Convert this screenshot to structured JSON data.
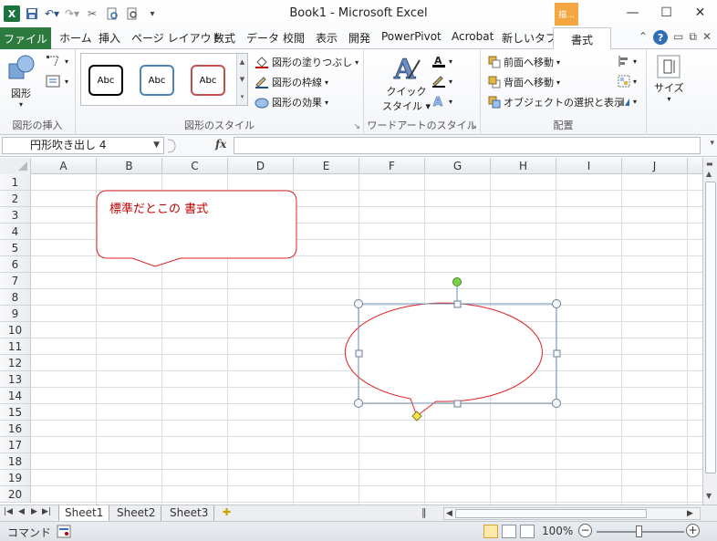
{
  "window": {
    "title": "Book1 - Microsoft Excel",
    "context_tab_header": "描...",
    "minimize_glyph": "—",
    "maximize_glyph": "☐",
    "close_glyph": "✕"
  },
  "qat": {
    "icons": [
      "excel-logo",
      "save-icon",
      "undo-icon",
      "redo-icon",
      "cut-icon",
      "print-preview-icon",
      "quick-print-icon",
      "customize-icon"
    ]
  },
  "tabs": {
    "file": "ファイル",
    "items": [
      "ホーム",
      "挿入",
      "ページ レイアウト",
      "数式",
      "データ",
      "校閲",
      "表示",
      "開発",
      "PowerPivot",
      "Acrobat",
      "新しいタブ"
    ],
    "active": "書式"
  },
  "ribbon": {
    "insert_shapes": {
      "shape_label": "図形",
      "group_label": "図形の挿入"
    },
    "shape_styles": {
      "style_samples": [
        "Abc",
        "Abc",
        "Abc"
      ],
      "style_colors": [
        "#000000",
        "#4f81bd",
        "#c0504d"
      ],
      "fill": "図形の塗りつぶし",
      "outline": "図形の枠線",
      "effects": "図形の効果",
      "group_label": "図形のスタイル"
    },
    "wordart": {
      "quick_style_line1": "クイック",
      "quick_style_line2": "スタイル",
      "group_label": "ワードアートのスタイル"
    },
    "arrange": {
      "bring_forward": "前面へ移動",
      "send_backward": "背面へ移動",
      "selection_pane": "オブジェクトの選択と表示",
      "group_label": "配置"
    },
    "size": {
      "label": "サイズ"
    }
  },
  "formula_bar": {
    "name_box": "円形吹き出し 4",
    "fx": "fx",
    "formula": ""
  },
  "sheet": {
    "columns": [
      "A",
      "B",
      "C",
      "D",
      "E",
      "F",
      "G",
      "H",
      "I",
      "J"
    ],
    "rows": [
      "1",
      "2",
      "3",
      "4",
      "5",
      "6",
      "7",
      "8",
      "9",
      "10",
      "11",
      "12",
      "13",
      "14",
      "15",
      "16",
      "17",
      "18",
      "19",
      "20"
    ],
    "callout_text": "標準だとこの 書式",
    "shape_line_color": "#e02020",
    "selection_color": "#6d8fb3",
    "handle_rotate_color": "#7ed04a",
    "handle_adjust_color": "#f5e44a"
  },
  "sheet_tabs": [
    "Sheet1",
    "Sheet2",
    "Sheet3"
  ],
  "status": {
    "mode": "コマンド",
    "zoom": "100%"
  }
}
